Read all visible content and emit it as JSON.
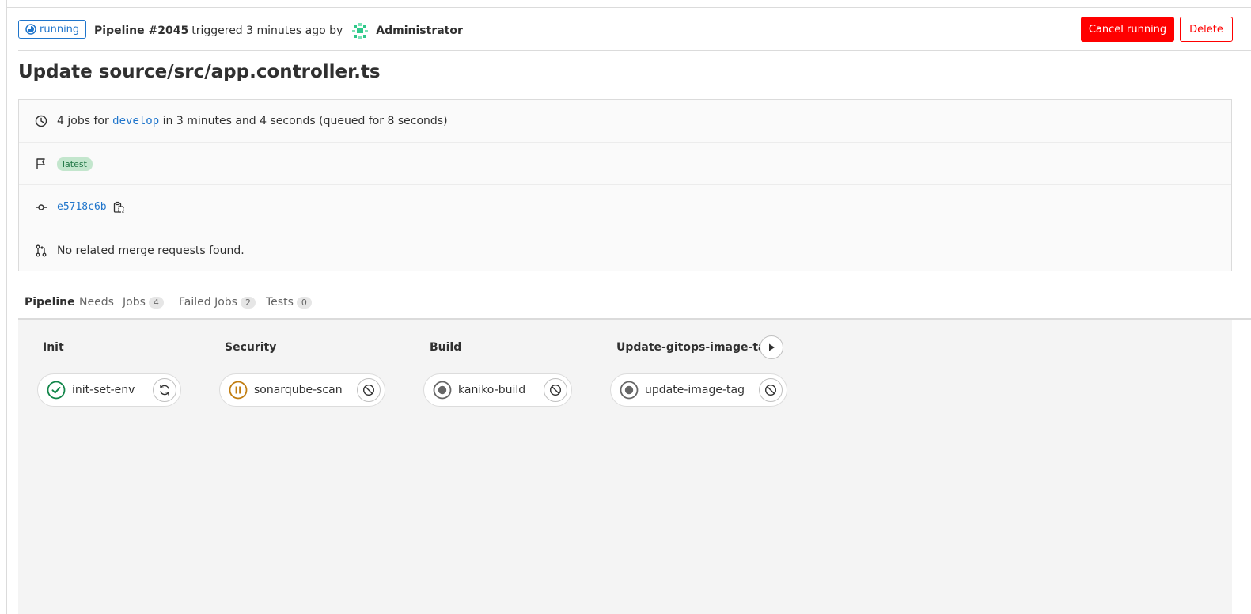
{
  "header": {
    "status": "running",
    "pipeline_id": "Pipeline #2045",
    "triggered_text": "triggered 3 minutes ago by",
    "user": "Administrator",
    "cancel_label": "Cancel running",
    "delete_label": "Delete"
  },
  "title": "Update source/src/app.controller.ts",
  "info": {
    "jobs_prefix": "4 jobs for",
    "branch": "develop",
    "jobs_suffix": "in 3 minutes and 4 seconds (queued for 8 seconds)",
    "tag": "latest",
    "commit_sha": "e5718c6b",
    "merge_requests": "No related merge requests found."
  },
  "tabs": [
    {
      "label": "Pipeline"
    },
    {
      "label": "Needs"
    },
    {
      "label": "Jobs",
      "count": "4"
    },
    {
      "label": "Failed Jobs",
      "count": "2"
    },
    {
      "label": "Tests",
      "count": "0"
    }
  ],
  "stages": [
    {
      "name": "Init",
      "job": "init-set-env",
      "job_status": "success",
      "action": "retry-icon"
    },
    {
      "name": "Security",
      "job": "sonarqube-scan",
      "job_status": "manual-paused",
      "action": "cancel-icon"
    },
    {
      "name": "Build",
      "job": "kaniko-build",
      "job_status": "created",
      "action": "cancel-icon"
    },
    {
      "name": "Update-gitops-image-tag",
      "job": "update-image-tag",
      "job_status": "created",
      "action": "cancel-icon"
    }
  ],
  "colors": {
    "running": "#1f75cb",
    "danger": "#ff0000",
    "success": "#108548",
    "manual": "#c17d10",
    "created": "#666666",
    "tab_active": "#6e49cb"
  }
}
